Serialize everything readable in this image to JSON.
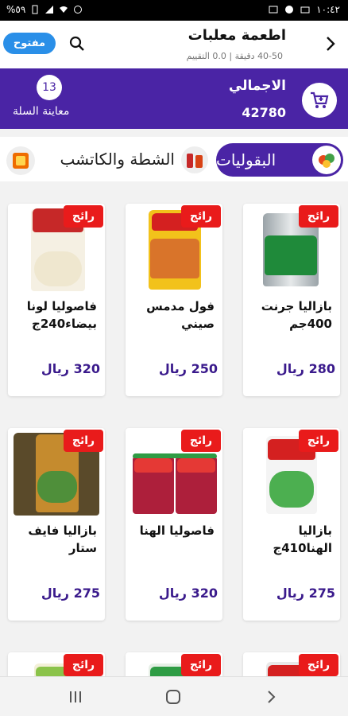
{
  "status": {
    "battery": "%٥٩",
    "time": "١٠:٤٢"
  },
  "header": {
    "title": "اطعمة معلبات",
    "subtitle": "40-50 دقيقة | 0.0 التقييم",
    "open_label": "مفتوح"
  },
  "cart": {
    "total_label": "الاجمالي",
    "total_value": "42780",
    "count": "13",
    "preview_label": "معاينة السلة"
  },
  "categories": [
    {
      "label": "البقوليات",
      "active": true
    },
    {
      "label": "الشطة والكاتشب",
      "active": false
    },
    {
      "label": "",
      "active": false
    }
  ],
  "badge_label": "رائج",
  "products": [
    {
      "name": "بازاليا جرنت 400جم",
      "price": "280 ريال"
    },
    {
      "name": "فول مدمس صيني",
      "price": "250 ريال"
    },
    {
      "name": "فاصوليا لونا بيضاء240ج",
      "price": "320 ريال"
    },
    {
      "name": "بازاليا الهنا410ج",
      "price": "275 ريال"
    },
    {
      "name": "فاصوليا الهنا",
      "price": "320 ريال"
    },
    {
      "name": "بازاليا فايف ستار",
      "price": "275 ريال"
    },
    {
      "name": "",
      "price": ""
    },
    {
      "name": "",
      "price": ""
    },
    {
      "name": "",
      "price": ""
    }
  ],
  "colors": {
    "primary": "#4a24a5",
    "accent_blue": "#2a8fe8",
    "badge_red": "#e91b1b"
  }
}
